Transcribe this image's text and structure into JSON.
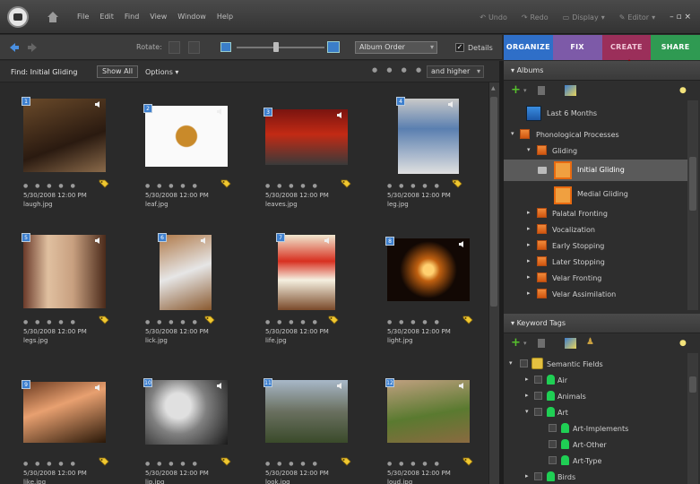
{
  "menu": [
    "File",
    "Edit",
    "Find",
    "View",
    "Window",
    "Help"
  ],
  "menu_right": {
    "undo": "Undo",
    "redo": "Redo",
    "display": "Display",
    "editor": "Editor",
    "window_controls": "– ▫ ×"
  },
  "toolbar": {
    "rotate_label": "Rotate:",
    "album_order": "Album Order",
    "details_label": "Details",
    "details_checked": true
  },
  "tabs": [
    {
      "label": "ORGANIZE",
      "color": "#2f6fc8"
    },
    {
      "label": "FIX",
      "color": "#7d5aa8"
    },
    {
      "label": "CREATE",
      "color": "#9b2f5a"
    },
    {
      "label": "SHARE",
      "color": "#2f9a52"
    }
  ],
  "findbar": {
    "find_text": "Find: Initial Gliding",
    "show_all": "Show All",
    "options": "Options ▾",
    "rating_filter": "and higher"
  },
  "photos": [
    {
      "index": "1",
      "date": "5/30/2008 12:00 PM",
      "file": "laugh.jpg",
      "has_audio": true
    },
    {
      "index": "2",
      "date": "5/30/2008 12:00 PM",
      "file": "leaf.jpg",
      "has_audio": true
    },
    {
      "index": "3",
      "date": "5/30/2008 12:00 PM",
      "file": "leaves.jpg",
      "has_audio": true
    },
    {
      "index": "4",
      "date": "5/30/2008 12:00 PM",
      "file": "leg.jpg",
      "has_audio": true
    },
    {
      "index": "5",
      "date": "5/30/2008 12:00 PM",
      "file": "legs.jpg",
      "has_audio": true
    },
    {
      "index": "6",
      "date": "5/30/2008 12:00 PM",
      "file": "lick.jpg",
      "has_audio": true
    },
    {
      "index": "7",
      "date": "5/30/2008 12:00 PM",
      "file": "life.jpg",
      "has_audio": true
    },
    {
      "index": "8",
      "date": "5/30/2008 12:00 PM",
      "file": "light.jpg",
      "has_audio": true
    },
    {
      "index": "9",
      "date": "5/30/2008 12:00 PM",
      "file": "like.jpg",
      "has_audio": true
    },
    {
      "index": "10",
      "date": "5/30/2008 12:00 PM",
      "file": "lip.jpg",
      "has_audio": true
    },
    {
      "index": "11",
      "date": "5/30/2008 12:00 PM",
      "file": "look.jpg",
      "has_audio": true
    },
    {
      "index": "12",
      "date": "5/30/2008 12:00 PM",
      "file": "loud.jpg",
      "has_audio": true
    }
  ],
  "albums": {
    "title": "Albums",
    "items": [
      {
        "label": "Last 6 Months",
        "kind": "smart"
      },
      {
        "label": "Phonological Processes",
        "kind": "group",
        "expanded": true
      },
      {
        "label": "Gliding",
        "kind": "group",
        "expanded": true
      },
      {
        "label": "Initial Gliding",
        "kind": "album",
        "selected": true
      },
      {
        "label": "Medial Gliding",
        "kind": "album"
      },
      {
        "label": "Palatal Fronting",
        "kind": "group"
      },
      {
        "label": "Vocalization",
        "kind": "group"
      },
      {
        "label": "Early Stopping",
        "kind": "group"
      },
      {
        "label": "Later Stopping",
        "kind": "group"
      },
      {
        "label": "Velar Fronting",
        "kind": "group"
      },
      {
        "label": "Velar Assimilation",
        "kind": "group"
      }
    ]
  },
  "keywords": {
    "title": "Keyword Tags",
    "items": [
      {
        "label": "Semantic Fields",
        "level": 0,
        "expanded": true
      },
      {
        "label": "Air",
        "level": 1
      },
      {
        "label": "Animals",
        "level": 1
      },
      {
        "label": "Art",
        "level": 1,
        "expanded": true
      },
      {
        "label": "Art-Implements",
        "level": 2
      },
      {
        "label": "Art-Other",
        "level": 2
      },
      {
        "label": "Art-Type",
        "level": 2
      },
      {
        "label": "Birds",
        "level": 1
      }
    ]
  }
}
